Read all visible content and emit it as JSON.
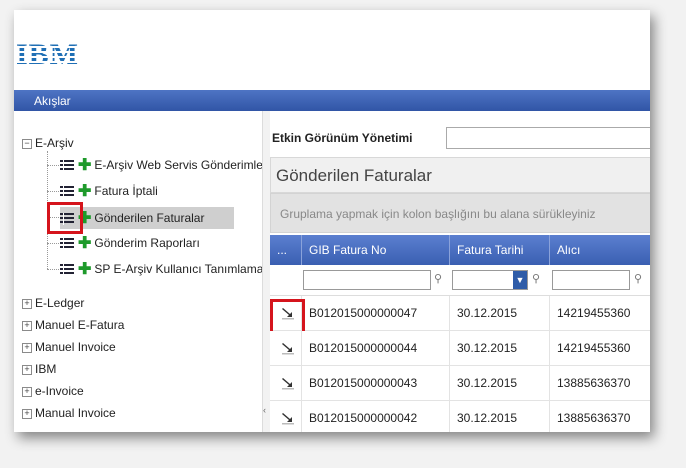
{
  "logo": {
    "text": "IBM"
  },
  "menubar": {
    "title": "Akışlar"
  },
  "tree": {
    "root": "E-Arşiv",
    "children": [
      "E-Arşiv Web Servis Gönderimle",
      "Fatura İptali",
      "Gönderilen Faturalar",
      "Gönderim Raporları",
      "SP E-Arşiv Kullanıcı Tanımlama"
    ],
    "selected_index": 2,
    "collapsed": [
      "E-Ledger",
      "Manuel E-Fatura",
      "Manuel Invoice",
      "IBM",
      "e-Invoice",
      "Manual Invoice"
    ]
  },
  "view": {
    "label": "Etkin Görünüm Yönetimi",
    "value": ""
  },
  "panel": {
    "title": "Gönderilen Faturalar",
    "group_hint": "Gruplama yapmak için kolon başlığını bu alana sürükleyiniz"
  },
  "grid": {
    "headers": [
      "...",
      "GIB Fatura No",
      "Fatura Tarihi",
      "Alıcı"
    ],
    "rows": [
      {
        "no": "B012015000000047",
        "date": "30.12.2015",
        "recipient": "14219455360"
      },
      {
        "no": "B012015000000044",
        "date": "30.12.2015",
        "recipient": "14219455360"
      },
      {
        "no": "B012015000000043",
        "date": "30.12.2015",
        "recipient": "13885636370"
      },
      {
        "no": "B012015000000042",
        "date": "30.12.2015",
        "recipient": "13885636370"
      }
    ]
  },
  "colors": {
    "accent": "#3a5fb2",
    "highlight": "#d5141c",
    "add_green": "#1e9a2b"
  }
}
